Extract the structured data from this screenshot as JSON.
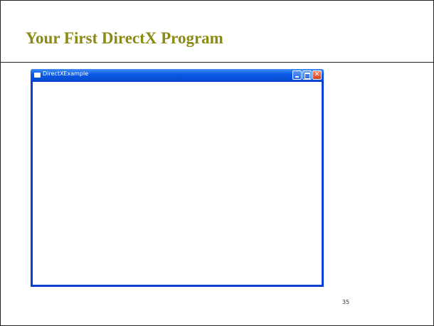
{
  "slide": {
    "title": "Your First DirectX Program",
    "page_number": "35"
  },
  "window": {
    "title": "DirectXExample",
    "app_icon": "window-icon",
    "controls": {
      "minimize_icon": "minimize-icon",
      "maximize_icon": "maximize-icon",
      "close_icon": "close-icon",
      "close_glyph": "✕"
    }
  },
  "colors": {
    "title_text": "#8a8a14",
    "window_frame": "#0a3fd0",
    "titlebar_top": "#3f8cf3",
    "close_button": "#d2421d"
  }
}
